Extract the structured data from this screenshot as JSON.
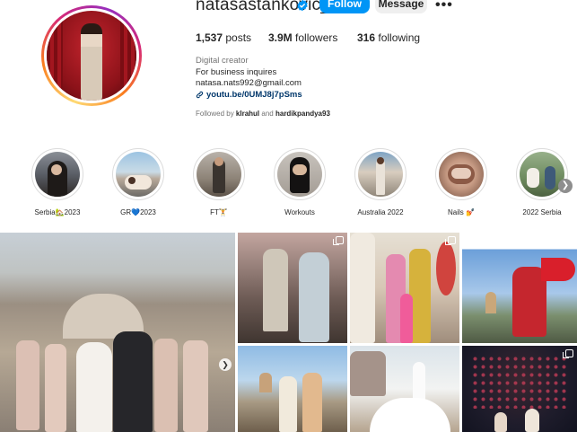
{
  "profile": {
    "username": "natasastankovic__",
    "follow_label": "Follow",
    "message_label": "Message",
    "more_label": "•••",
    "stats": {
      "posts_count": "1,537",
      "posts_label": "posts",
      "followers_count": "3.9M",
      "followers_label": "followers",
      "following_count": "316",
      "following_label": "following"
    },
    "bio": {
      "category": "Digital creator",
      "line1": "For business inquires",
      "email": "natasa.nats992@gmail.com",
      "link": "youtu.be/0UMJ8j7pSms"
    },
    "followed_by": {
      "prefix": "Followed by",
      "user1": "klrahul",
      "and": "and",
      "user2": "hardikpandya93"
    }
  },
  "highlights": [
    {
      "label": "Serbia🏡2023"
    },
    {
      "label": "GR💙2023"
    },
    {
      "label": "FT🏋"
    },
    {
      "label": "Workouts"
    },
    {
      "label": "Australia 2022"
    },
    {
      "label": "Nails 💅"
    },
    {
      "label": "2022 Serbia"
    }
  ],
  "icons": {
    "verified": "verified-badge-icon",
    "link": "link-icon",
    "next": "chevron-right-icon",
    "multi": "carousel-icon"
  },
  "colors": {
    "accent": "#0095f6",
    "link": "#00376b",
    "secondary_text": "#737373"
  }
}
